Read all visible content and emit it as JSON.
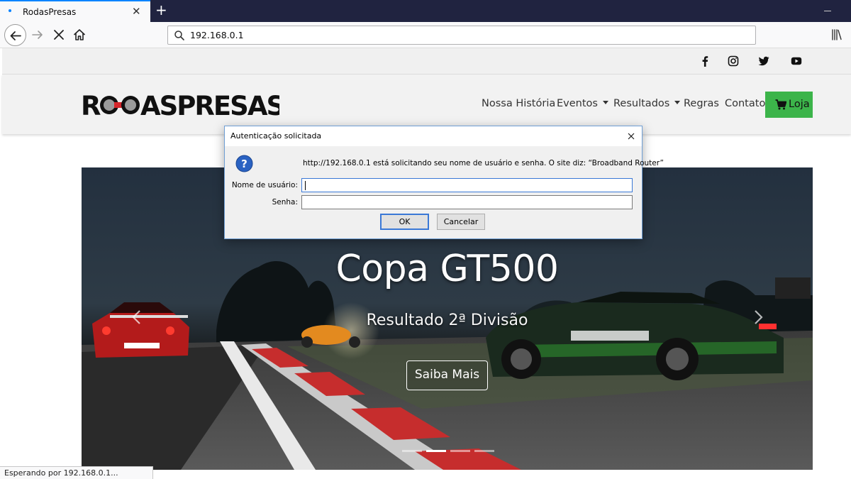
{
  "browser": {
    "tab_title": "RodasPresas",
    "tab_close": "✕",
    "new_tab": "+",
    "url": "192.168.0.1",
    "status": "Esperando por 192.168.0.1..."
  },
  "site": {
    "logo": "RodasPresas",
    "logo_display": "R◉DASPRESAS",
    "social": [
      "facebook-icon",
      "instagram-icon",
      "twitter-icon",
      "youtube-icon"
    ],
    "nav": {
      "historia": "Nossa História",
      "eventos": "Eventos",
      "resultados": "Resultados",
      "regras": "Regras",
      "contato": "Contato",
      "loja": "Loja"
    },
    "accent": "#3cb44a",
    "hero": {
      "title": "Copa GT500",
      "subtitle": "Resultado 2ª Divisão",
      "button": "Saiba Mais",
      "indicators": 4,
      "active_indicator": 2
    }
  },
  "dialog": {
    "title": "Autenticação solicitada",
    "message": "http://192.168.0.1 está solicitando seu nome de usuário e senha. O site diz: “Broadband Router”",
    "username_label": "Nome de usuário:",
    "password_label": "Senha:",
    "username_value": "",
    "password_value": "",
    "ok": "OK",
    "cancel": "Cancelar"
  }
}
